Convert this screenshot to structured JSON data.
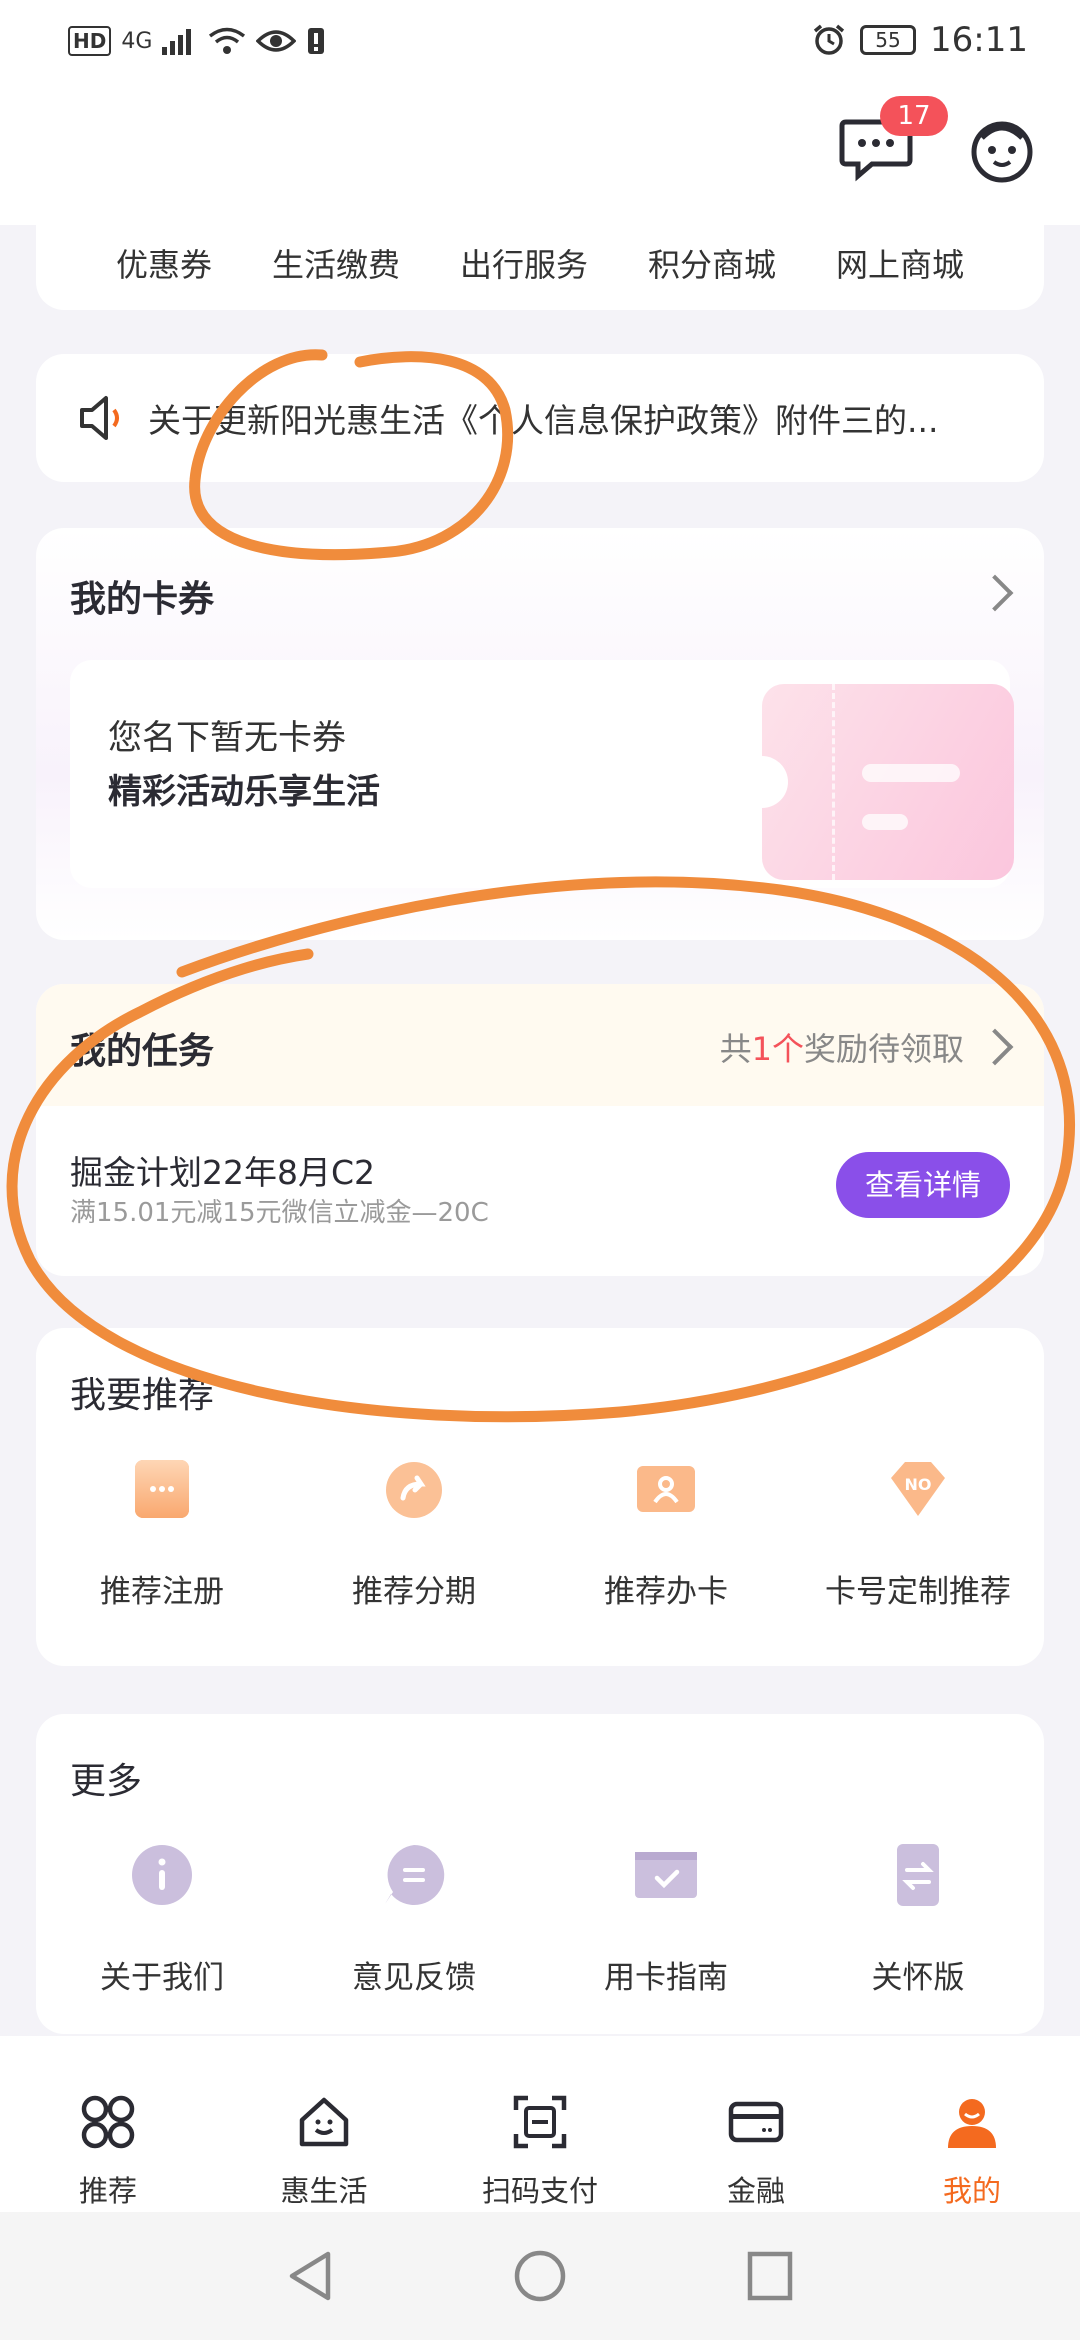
{
  "status_bar": {
    "hd": "HD",
    "network": "4G",
    "battery": "55",
    "time": "16:11"
  },
  "header": {
    "message_badge": "17"
  },
  "services": [
    "优惠券",
    "生活缴费",
    "出行服务",
    "积分商城",
    "网上商城"
  ],
  "notice": {
    "text": "关于更新阳光惠生活《个人信息保护政策》附件三的..."
  },
  "coupons": {
    "title": "我的卡券",
    "empty_line1": "您名下暂无卡券",
    "empty_line2": "精彩活动乐享生活"
  },
  "tasks": {
    "title": "我的任务",
    "hint_prefix": "共",
    "hint_count": "1个",
    "hint_suffix": "奖励待领取",
    "task_name": "掘金计划22年8月C2",
    "task_desc": "满15.01元减15元微信立减金—20C",
    "detail_button": "查看详情"
  },
  "recommend": {
    "title": "我要推荐",
    "items": [
      {
        "label": "推荐注册",
        "icon": "register-icon"
      },
      {
        "label": "推荐分期",
        "icon": "share-installment-icon"
      },
      {
        "label": "推荐办卡",
        "icon": "apply-card-icon"
      },
      {
        "label": "卡号定制推荐",
        "icon": "card-number-icon"
      }
    ]
  },
  "more": {
    "title": "更多",
    "items": [
      {
        "label": "关于我们",
        "icon": "info-icon"
      },
      {
        "label": "意见反馈",
        "icon": "feedback-icon"
      },
      {
        "label": "用卡指南",
        "icon": "card-guide-icon"
      },
      {
        "label": "关怀版",
        "icon": "care-mode-icon"
      }
    ]
  },
  "tabbar": [
    {
      "label": "推荐",
      "icon": "grid-icon"
    },
    {
      "label": "惠生活",
      "icon": "house-icon"
    },
    {
      "label": "扫码支付",
      "icon": "scan-icon"
    },
    {
      "label": "金融",
      "icon": "card-icon"
    },
    {
      "label": "我的",
      "icon": "person-icon",
      "active": true
    }
  ],
  "colors": {
    "accent_orange": "#f46a1f",
    "accent_purple": "#8a4fe9",
    "badge_red": "#f4525a",
    "annotation": "#f08c3c"
  }
}
